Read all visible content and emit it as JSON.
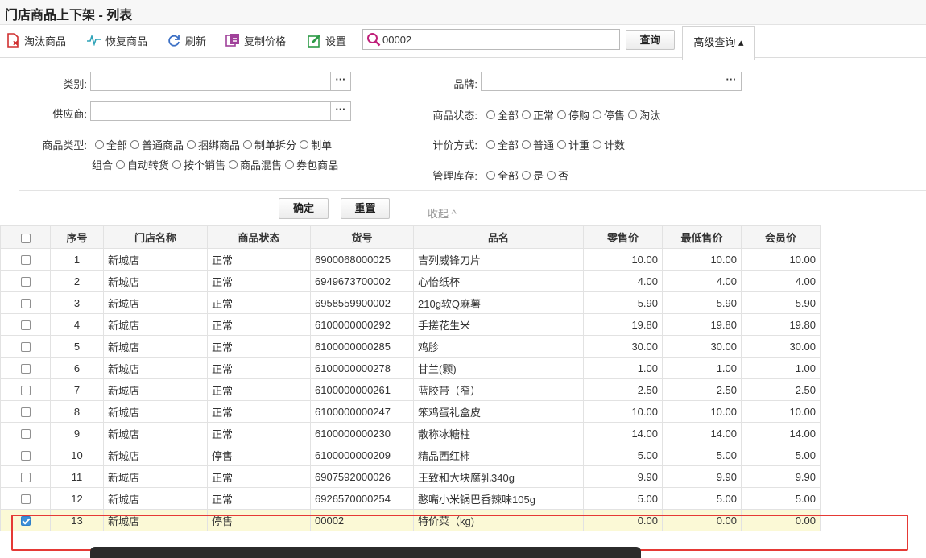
{
  "title": "门店商品上下架 - 列表",
  "toolbar": {
    "items": [
      {
        "label": "淘汰商品",
        "icon": "eliminate-icon"
      },
      {
        "label": "恢复商品",
        "icon": "restore-icon"
      },
      {
        "label": "刷新",
        "icon": "refresh-icon"
      },
      {
        "label": "复制价格",
        "icon": "copy-price-icon"
      },
      {
        "label": "设置",
        "icon": "settings-icon"
      }
    ],
    "search_value": "00002",
    "query_label": "查询",
    "advanced_label": "高级查询 ▴"
  },
  "filters": {
    "category_label": "类别:",
    "supplier_label": "供应商:",
    "product_type_label": "商品类型:",
    "product_type_options": [
      "全部",
      "普通商品",
      "捆绑商品",
      "制单拆分",
      "制单组合",
      "自动转货",
      "按个销售",
      "商品混售",
      "券包商品"
    ],
    "brand_label": "品牌:",
    "status_label": "商品状态:",
    "status_options": [
      "全部",
      "正常",
      "停购",
      "停售",
      "淘汰"
    ],
    "pricing_label": "计价方式:",
    "pricing_options": [
      "全部",
      "普通",
      "计重",
      "计数"
    ],
    "stock_label": "管理库存:",
    "stock_options": [
      "全部",
      "是",
      "否"
    ],
    "dots": "···",
    "confirm_label": "确定",
    "reset_label": "重置",
    "collapse_label": "收起 ^"
  },
  "table": {
    "columns": [
      "序号",
      "门店名称",
      "商品状态",
      "货号",
      "品名",
      "零售价",
      "最低售价",
      "会员价"
    ],
    "rows": [
      {
        "no": "1",
        "store": "新城店",
        "status": "正常",
        "code": "6900068000025",
        "name": "吉列威锋刀片",
        "retail": "10.00",
        "min": "10.00",
        "member": "10.00"
      },
      {
        "no": "2",
        "store": "新城店",
        "status": "正常",
        "code": "6949673700002",
        "name": "心怡纸杯",
        "retail": "4.00",
        "min": "4.00",
        "member": "4.00"
      },
      {
        "no": "3",
        "store": "新城店",
        "status": "正常",
        "code": "6958559900002",
        "name": "210g软Q麻薯",
        "retail": "5.90",
        "min": "5.90",
        "member": "5.90"
      },
      {
        "no": "4",
        "store": "新城店",
        "status": "正常",
        "code": "6100000000292",
        "name": "手搓花生米",
        "retail": "19.80",
        "min": "19.80",
        "member": "19.80"
      },
      {
        "no": "5",
        "store": "新城店",
        "status": "正常",
        "code": "6100000000285",
        "name": "鸡胗",
        "retail": "30.00",
        "min": "30.00",
        "member": "30.00"
      },
      {
        "no": "6",
        "store": "新城店",
        "status": "正常",
        "code": "6100000000278",
        "name": "甘兰(颗)",
        "retail": "1.00",
        "min": "1.00",
        "member": "1.00"
      },
      {
        "no": "7",
        "store": "新城店",
        "status": "正常",
        "code": "6100000000261",
        "name": "蓝胶带（窄）",
        "retail": "2.50",
        "min": "2.50",
        "member": "2.50"
      },
      {
        "no": "8",
        "store": "新城店",
        "status": "正常",
        "code": "6100000000247",
        "name": "笨鸡蛋礼盒皮",
        "retail": "10.00",
        "min": "10.00",
        "member": "10.00"
      },
      {
        "no": "9",
        "store": "新城店",
        "status": "正常",
        "code": "6100000000230",
        "name": "散称冰糖柱",
        "retail": "14.00",
        "min": "14.00",
        "member": "14.00"
      },
      {
        "no": "10",
        "store": "新城店",
        "status": "停售",
        "code": "6100000000209",
        "name": "精品西红柿",
        "retail": "5.00",
        "min": "5.00",
        "member": "5.00"
      },
      {
        "no": "11",
        "store": "新城店",
        "status": "正常",
        "code": "6907592000026",
        "name": "王致和大块腐乳340g",
        "retail": "9.90",
        "min": "9.90",
        "member": "9.90"
      },
      {
        "no": "12",
        "store": "新城店",
        "status": "正常",
        "code": "6926570000254",
        "name": "憨嘴小米锅巴香辣味105g",
        "retail": "5.00",
        "min": "5.00",
        "member": "5.00"
      },
      {
        "no": "13",
        "store": "新城店",
        "status": "停售",
        "code": "00002",
        "name": "特价菜（kg)",
        "retail": "0.00",
        "min": "0.00",
        "member": "0.00",
        "selected": true
      }
    ]
  }
}
